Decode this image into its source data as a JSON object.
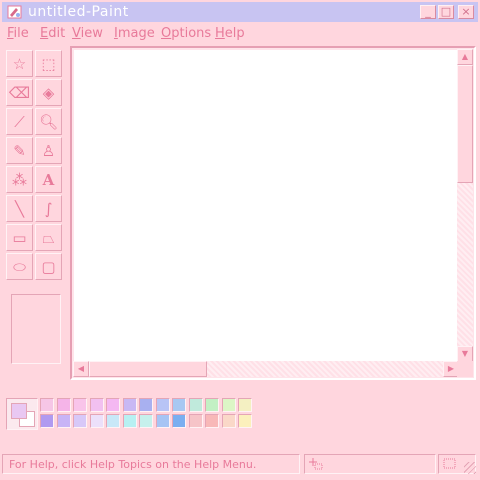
{
  "window": {
    "title": "untitled-Paint",
    "controls": {
      "minimize": "_",
      "maximize": "□",
      "close": "×"
    }
  },
  "menu": [
    {
      "label": "File"
    },
    {
      "label": "Edit"
    },
    {
      "label": "View"
    },
    {
      "label": "Image"
    },
    {
      "label": "Options"
    },
    {
      "label": "Help"
    }
  ],
  "tools": [
    {
      "name": "free-form-select",
      "icon": "star-select-icon",
      "glyph": "☆"
    },
    {
      "name": "select",
      "icon": "rect-select-icon",
      "glyph": "⬚"
    },
    {
      "name": "eraser",
      "icon": "eraser-icon",
      "glyph": "⌫"
    },
    {
      "name": "fill",
      "icon": "paint-bucket-icon",
      "glyph": "◈"
    },
    {
      "name": "pick-color",
      "icon": "eyedropper-icon",
      "glyph": "⟋"
    },
    {
      "name": "magnifier",
      "icon": "magnifier-icon",
      "glyph": "🔍︎"
    },
    {
      "name": "pencil",
      "icon": "pencil-icon",
      "glyph": "✎"
    },
    {
      "name": "brush",
      "icon": "brush-icon",
      "glyph": "♙"
    },
    {
      "name": "airbrush",
      "icon": "airbrush-icon",
      "glyph": "⁂"
    },
    {
      "name": "text",
      "icon": "text-icon",
      "glyph": "A"
    },
    {
      "name": "line",
      "icon": "line-icon",
      "glyph": "╲"
    },
    {
      "name": "curve",
      "icon": "curve-icon",
      "glyph": "∫"
    },
    {
      "name": "rectangle",
      "icon": "rectangle-icon",
      "glyph": "▭"
    },
    {
      "name": "polygon",
      "icon": "polygon-icon",
      "glyph": "⏢"
    },
    {
      "name": "ellipse",
      "icon": "ellipse-icon",
      "glyph": "⬭"
    },
    {
      "name": "rounded-rectangle",
      "icon": "rounded-rectangle-icon",
      "glyph": "▢"
    }
  ],
  "colors": {
    "foreground": "#e9c8f2",
    "background": "#ffffff",
    "palette_row1": [
      "#f6c6e6",
      "#f5b4e8",
      "#f9c4ea",
      "#f2c0f0",
      "#f4b8f2",
      "#c9b8f4",
      "#a8b0f0",
      "#b8c4f6",
      "#a8c8f2",
      "#c0eadc",
      "#c2f0c4",
      "#dcf6c6",
      "#f4f0c2"
    ],
    "palette_row2": [
      "#b09af0",
      "#c8b4f6",
      "#d8c8f8",
      "#ece0fa",
      "#c8e8f8",
      "#b8f0f2",
      "#c6f0ec",
      "#a6c4f4",
      "#7aaef0",
      "#f6c4c8",
      "#f8b8b8",
      "#fad8c8",
      "#fcf0bc"
    ]
  },
  "status": {
    "help_text": "For Help, click Help Topics on the Help Menu."
  }
}
